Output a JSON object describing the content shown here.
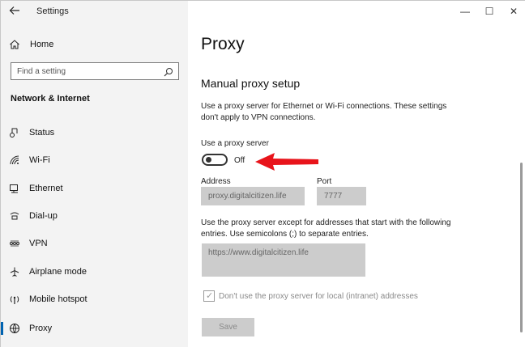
{
  "window": {
    "app_title": "Settings",
    "controls": {
      "minimize": "—",
      "maximize": "☐",
      "close": "✕"
    }
  },
  "sidebar": {
    "home_label": "Home",
    "search_placeholder": "Find a setting",
    "section_heading": "Network & Internet",
    "items": [
      {
        "label": "Status",
        "icon": "status-icon",
        "active": false
      },
      {
        "label": "Wi-Fi",
        "icon": "wifi-icon",
        "active": false
      },
      {
        "label": "Ethernet",
        "icon": "ethernet-icon",
        "active": false
      },
      {
        "label": "Dial-up",
        "icon": "dialup-icon",
        "active": false
      },
      {
        "label": "VPN",
        "icon": "vpn-icon",
        "active": false
      },
      {
        "label": "Airplane mode",
        "icon": "airplane-icon",
        "active": false
      },
      {
        "label": "Mobile hotspot",
        "icon": "hotspot-icon",
        "active": false
      },
      {
        "label": "Proxy",
        "icon": "proxy-icon",
        "active": true
      }
    ]
  },
  "main": {
    "page_title": "Proxy",
    "subtitle": "Manual proxy setup",
    "description": "Use a proxy server for Ethernet or Wi-Fi connections. These settings don't apply to VPN connections.",
    "toggle_label": "Use a proxy server",
    "toggle_state": "Off",
    "address_label": "Address",
    "address_value": "proxy.digitalcitizen.life",
    "port_label": "Port",
    "port_value": "7777",
    "exceptions_description": "Use the proxy server except for addresses that start with the following entries. Use semicolons (;) to separate entries.",
    "exceptions_value": "https://www.digitalcitizen.life",
    "bypass_local_label": "Don't use the proxy server for local (intranet) addresses",
    "bypass_local_checked": true,
    "save_label": "Save"
  },
  "colors": {
    "accent": "#0063b1",
    "annotation_arrow": "#e8141b"
  }
}
